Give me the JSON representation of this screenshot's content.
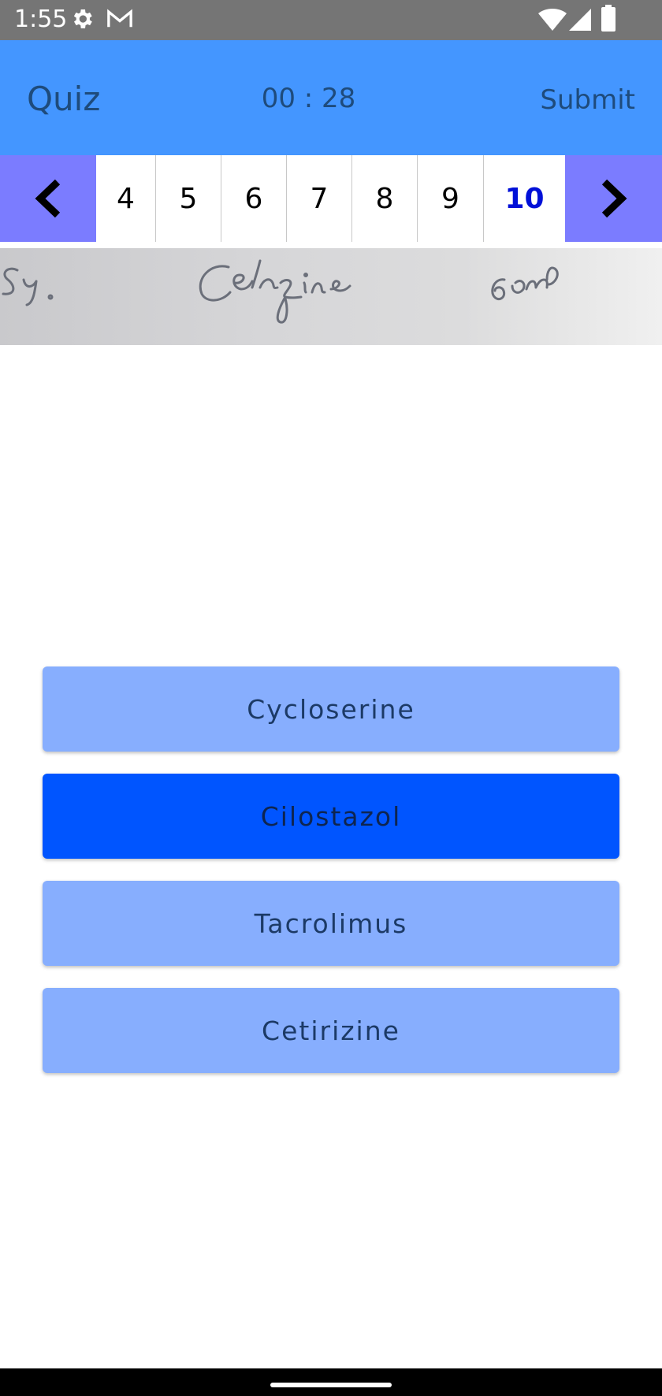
{
  "status_bar": {
    "time": "1:55",
    "icons": [
      "gear-icon",
      "gmail-icon",
      "wifi-icon",
      "signal-icon",
      "battery-icon"
    ]
  },
  "app_bar": {
    "title": "Quiz",
    "timer": "00 : 28",
    "submit_label": "Submit"
  },
  "question_nav": {
    "numbers": [
      "4",
      "5",
      "6",
      "7",
      "8",
      "9",
      "10"
    ],
    "current": "10"
  },
  "question": {
    "image_text": "Sy. Cetrizine 60ml"
  },
  "options": [
    {
      "label": "Cycloserine",
      "selected": false
    },
    {
      "label": "Cilostazol",
      "selected": true
    },
    {
      "label": "Tacrolimus",
      "selected": false
    },
    {
      "label": "Cetirizine",
      "selected": false
    }
  ],
  "colors": {
    "app_bar": "#4496ff",
    "nav_arrow": "#7b7cff",
    "option": "#87aefe",
    "option_selected": "#0055ff",
    "current_number": "#0010d8"
  }
}
